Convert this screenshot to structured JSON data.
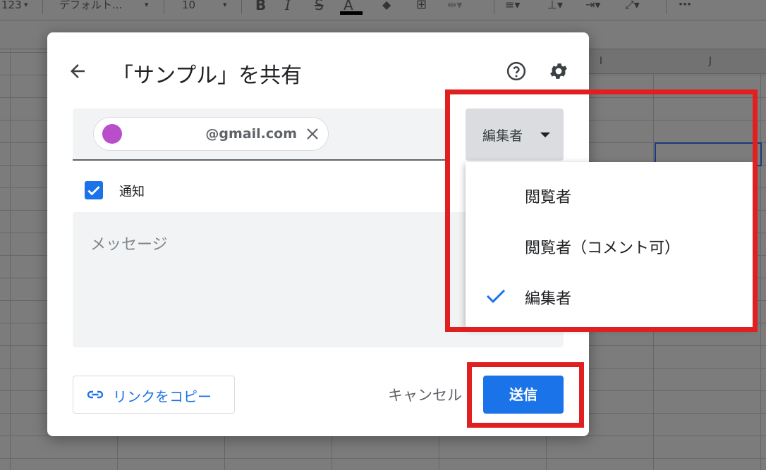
{
  "toolbar": {
    "format_number": "123",
    "font_name": "デフォルト...",
    "font_size": "10",
    "bold": "B",
    "italic": "I",
    "strike": "S",
    "text_color": "A",
    "more": "⋯"
  },
  "sheet": {
    "columns": [
      "I",
      "J"
    ]
  },
  "dialog": {
    "title": "「サンプル」を共有",
    "recipient_email": "@gmail.com",
    "role_selected": "編集者",
    "notify_label": "通知",
    "notify_checked": true,
    "message_placeholder": "メッセージ",
    "copy_link_label": "リンクをコピー",
    "cancel_label": "キャンセル",
    "send_label": "送信"
  },
  "role_menu": {
    "items": [
      {
        "label": "閲覧者",
        "checked": false
      },
      {
        "label": "閲覧者（コメント可）",
        "checked": false
      },
      {
        "label": "編集者",
        "checked": true
      }
    ]
  },
  "colors": {
    "accent": "#1a73e8",
    "highlight": "#e02020",
    "avatar": "#b84ec9"
  }
}
